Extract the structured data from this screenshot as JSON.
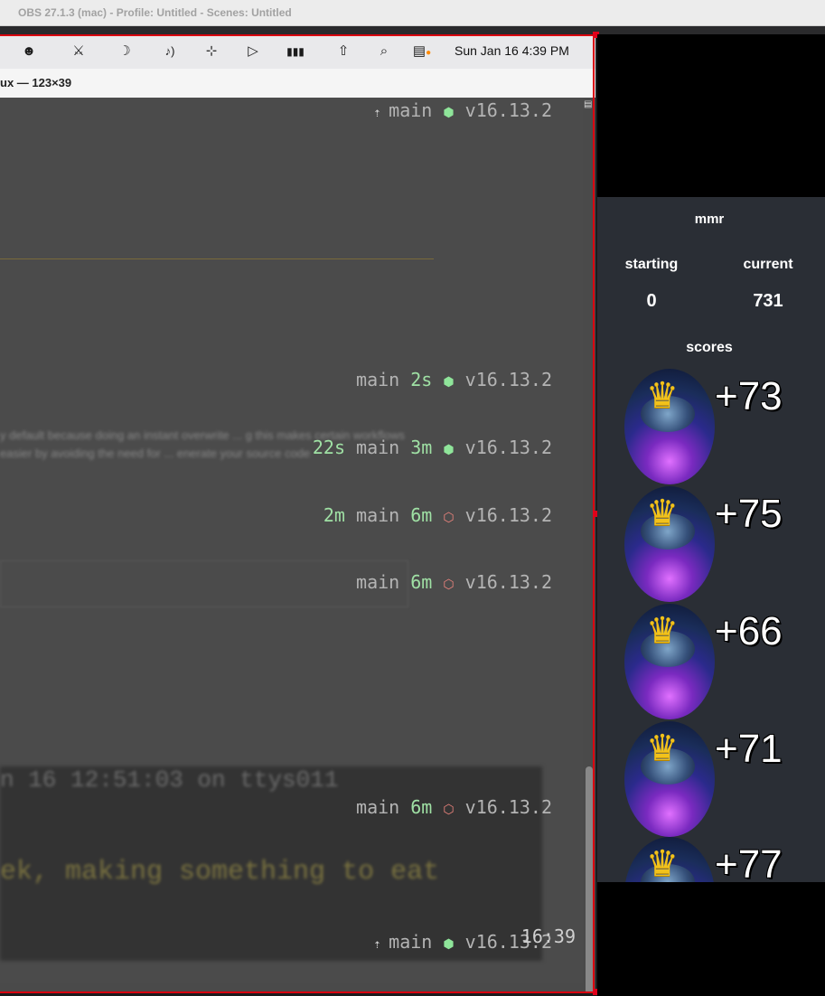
{
  "obs": {
    "title": "OBS 27.1.3 (mac) - Profile: Untitled - Scenes: Untitled"
  },
  "menubar": {
    "icons": [
      "user-icon",
      "activity-icon",
      "moon-icon",
      "volume-icon",
      "bluetooth-icon",
      "play-icon",
      "battery-icon",
      "wifi-icon",
      "search-icon",
      "control-center-icon"
    ],
    "clock": "Sun Jan 16  4:39 PM"
  },
  "terminal": {
    "title": "ux — 123×39",
    "lines": [
      {
        "arrow": "⇡ ",
        "pre": "",
        "branch": "main",
        "dur": "",
        "glyph": "⬢",
        "glyph_color": "green",
        "version": "v16.13.2"
      },
      {
        "arrow": "",
        "pre": "",
        "branch": "main",
        "dur": "2s",
        "glyph": "⬢",
        "glyph_color": "green",
        "version": "v16.13.2"
      },
      {
        "arrow": "",
        "pre": "22s",
        "branch": "main",
        "dur": "3m",
        "glyph": "⬢",
        "glyph_color": "green",
        "version": "v16.13.2"
      },
      {
        "arrow": "",
        "pre": "2m",
        "branch": "main",
        "dur": "6m",
        "glyph": "⬡",
        "glyph_color": "red",
        "version": "v16.13.2"
      },
      {
        "arrow": "",
        "pre": "",
        "branch": "main",
        "dur": "6m",
        "glyph": "⬡",
        "glyph_color": "red",
        "version": "v16.13.2"
      },
      {
        "arrow": "",
        "pre": "",
        "branch": "main",
        "dur": "6m",
        "glyph": "⬡",
        "glyph_color": "red",
        "version": "v16.13.2"
      },
      {
        "arrow": "⇡ ",
        "pre": "",
        "branch": "main",
        "dur": "",
        "glyph": "⬢",
        "glyph_color": "green",
        "version": "v16.13.2"
      }
    ],
    "clock": "16:39",
    "blurred": {
      "code": "n 16 12:51:03 on ttys011",
      "yellow": "ek, making something to eat",
      "paragraph": "y default because doing an instant overwrite ... g this makes certain workflows easier by avoiding the need for ... enerate your source code"
    }
  },
  "panel": {
    "title": "mmr",
    "starting_label": "starting",
    "current_label": "current",
    "starting_value": "0",
    "current_value": "731",
    "scores_title": "scores",
    "scores": [
      "+73",
      "+75",
      "+66",
      "+71",
      "+77"
    ]
  },
  "colors": {
    "selection": "#d9000f",
    "panel_bg": "#2a2e35",
    "branch_duration": "#9fe0a4",
    "node_ok": "#8fe59a",
    "node_warn": "#f0857e"
  }
}
